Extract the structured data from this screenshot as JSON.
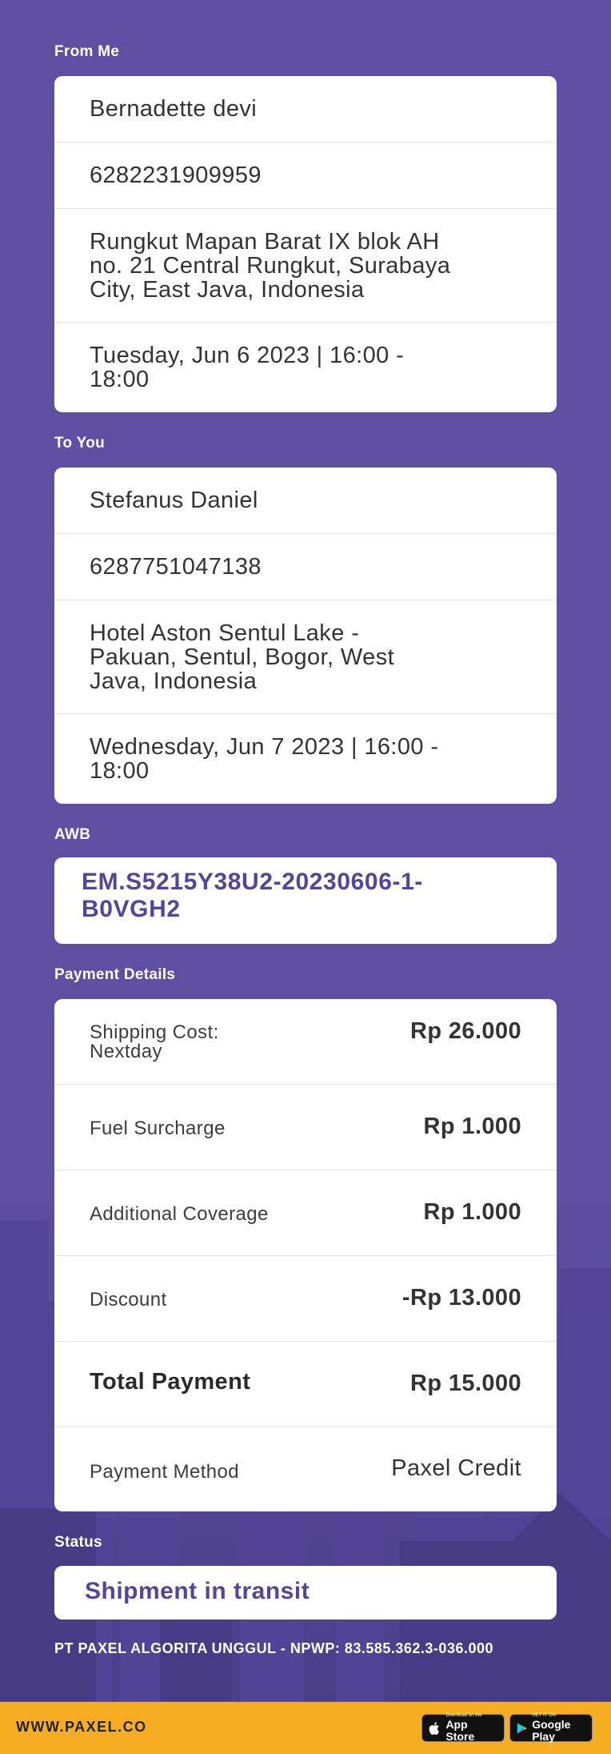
{
  "from": {
    "label": "From Me",
    "name": "Bernadette devi",
    "phone": "6282231909959",
    "address_lines": [
      "Rungkut Mapan Barat IX blok AH",
      "no. 21 Central Rungkut, Surabaya",
      "City, East Java, Indonesia"
    ],
    "schedule_lines": [
      "Tuesday, Jun 6 2023 | 16:00 -",
      "18:00"
    ]
  },
  "to": {
    "label": "To You",
    "name": "Stefanus Daniel",
    "phone": "6287751047138",
    "address_lines": [
      "Hotel Aston Sentul Lake -",
      "Pakuan, Sentul, Bogor, West",
      "Java, Indonesia"
    ],
    "schedule_lines": [
      "Wednesday, Jun 7 2023 | 16:00 -",
      "18:00"
    ]
  },
  "awb": {
    "label": "AWB",
    "lines": [
      "EM.S5215Y38U2-20230606-1-",
      "B0VGH2"
    ]
  },
  "payment": {
    "label": "Payment Details",
    "shipping_lines": [
      "Shipping Cost:",
      "Nextday"
    ],
    "shipping_value": "Rp 26.000",
    "fuel_label": "Fuel Surcharge",
    "fuel_value": "Rp 1.000",
    "coverage_label": "Additional Coverage",
    "coverage_value": "Rp 1.000",
    "discount_label": "Discount",
    "discount_value": "-Rp 13.000",
    "total_label": "Total Payment",
    "total_value": "Rp 15.000",
    "method_label": "Payment Method",
    "method_value": "Paxel Credit"
  },
  "status": {
    "label": "Status",
    "value": "Shipment in transit"
  },
  "company_line": "PT PAXEL ALGORITA UNGGUL - NPWP: 83.585.362.3-036.000",
  "footer": {
    "url": "WWW.PAXEL.CO",
    "appstore_small": "Download on the",
    "appstore_big": "App Store",
    "googleplay_small": "GET IT ON",
    "googleplay_big": "Google Play"
  },
  "colors": {
    "background": "#5e4fa2",
    "accent_text": "#54449a",
    "footer": "#f7ad22"
  }
}
